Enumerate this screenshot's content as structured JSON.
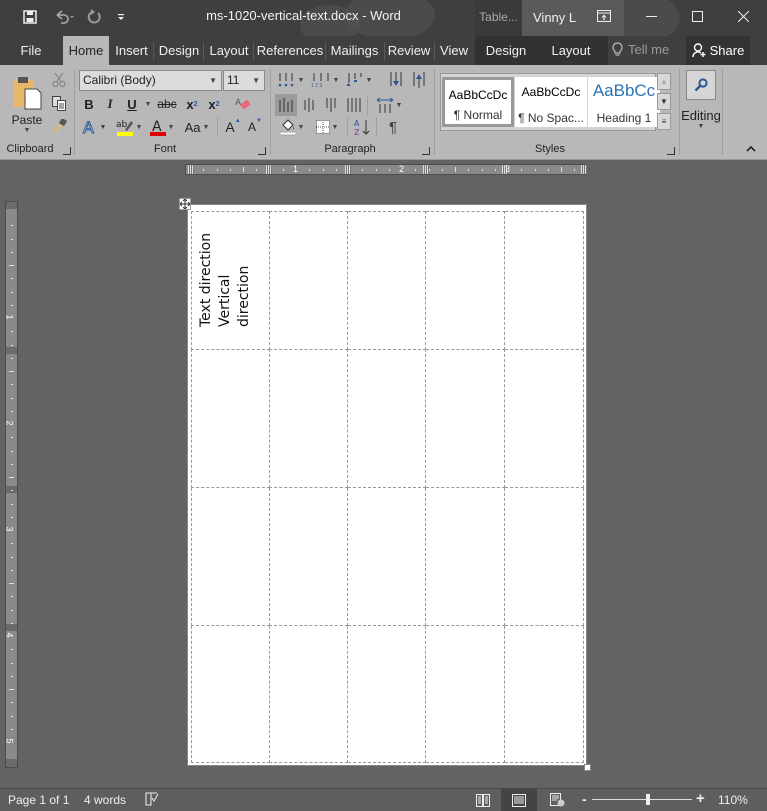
{
  "titlebar": {
    "document_title": "ms-1020-vertical-text.docx - Word",
    "context_group": "Table...",
    "user_name": "Vinny L",
    "qat": {
      "save_icon": "save-icon",
      "undo_icon": "undo-icon",
      "redo_icon": "redo-icon",
      "customize_icon": "customize-qat-icon"
    }
  },
  "tabs": [
    {
      "label": "File"
    },
    {
      "label": "Home",
      "active": true
    },
    {
      "label": "Insert"
    },
    {
      "label": "Design"
    },
    {
      "label": "Layout"
    },
    {
      "label": "References"
    },
    {
      "label": "Mailings"
    },
    {
      "label": "Review"
    },
    {
      "label": "View"
    }
  ],
  "context_tabs": [
    {
      "label": "Design"
    },
    {
      "label": "Layout"
    }
  ],
  "tell_me": "Tell me",
  "share": "Share",
  "ribbon": {
    "clipboard": {
      "label": "Clipboard",
      "paste": "Paste"
    },
    "font": {
      "label": "Font",
      "font_name": "Calibri (Body)",
      "font_size": "11",
      "bold": "B",
      "italic": "I",
      "underline": "U",
      "strikethrough": "abc",
      "subscript": "x",
      "superscript": "x",
      "change_case": "Aa",
      "grow": "A",
      "shrink": "A",
      "highlight_color": "#ffff00",
      "font_color": "#e00000"
    },
    "paragraph": {
      "label": "Paragraph",
      "pilcrow": "¶"
    },
    "styles": {
      "label": "Styles",
      "items": [
        {
          "sample": "AaBbCcDc",
          "name": "¶ Normal",
          "selected": true
        },
        {
          "sample": "AaBbCcDc",
          "name": "¶ No Spac..."
        },
        {
          "sample": "AaBbCc",
          "name": "Heading 1",
          "color": "#2e74b5"
        }
      ]
    },
    "editing": {
      "label": "Editing"
    }
  },
  "rulers": {
    "horizontal_numbers": [
      "1",
      "2",
      "3"
    ],
    "vertical_numbers": [
      "1",
      "2",
      "3",
      "4",
      "5"
    ]
  },
  "document": {
    "table": {
      "rows": 4,
      "columns": 5,
      "cells": [
        [
          "Text direction Vertical direction",
          "",
          "",
          "",
          ""
        ],
        [
          "",
          "",
          "",
          "",
          ""
        ],
        [
          "",
          "",
          "",
          "",
          ""
        ],
        [
          "",
          "",
          "",
          "",
          ""
        ]
      ],
      "first_cell_lines": [
        "Text direction",
        "Vertical",
        "direction"
      ]
    }
  },
  "statusbar": {
    "page": "Page 1 of 1",
    "words": "4 words",
    "zoom_percent": "110%",
    "zoom_value": 110
  }
}
